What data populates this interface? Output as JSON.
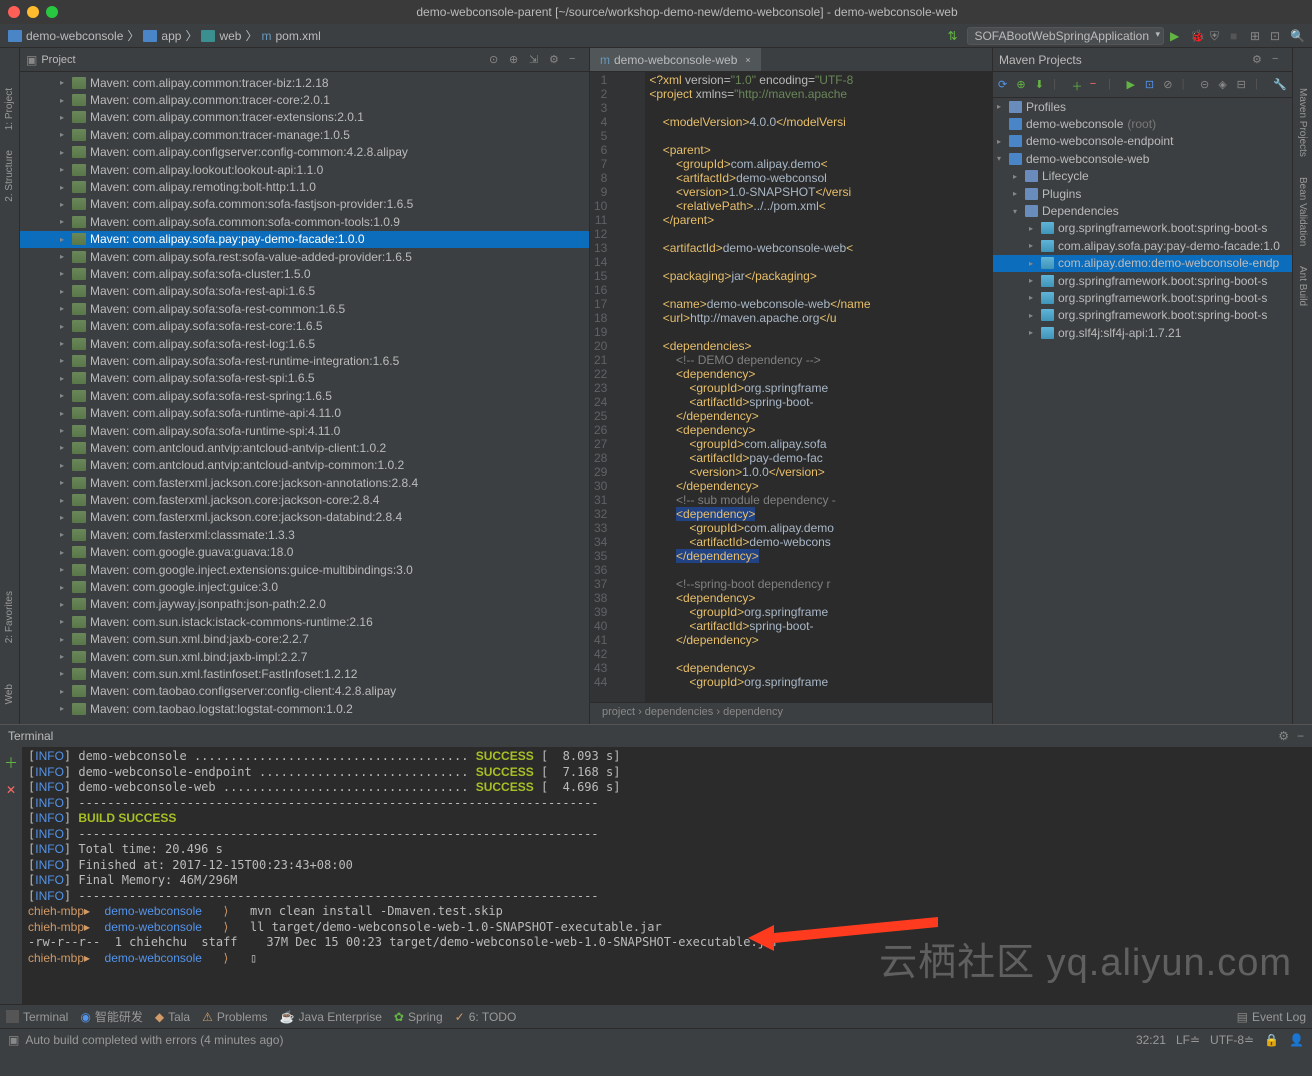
{
  "title": "demo-webconsole-parent [~/source/workshop-demo-new/demo-webconsole] - demo-webconsole-web",
  "breadcrumbs": [
    "demo-webconsole",
    "app",
    "web",
    "pom.xml"
  ],
  "run_config": "SOFABootWebSpringApplication",
  "project": {
    "title": "Project",
    "items": [
      {
        "t": "Maven: com.alipay.common:tracer-biz:1.2.18"
      },
      {
        "t": "Maven: com.alipay.common:tracer-core:2.0.1"
      },
      {
        "t": "Maven: com.alipay.common:tracer-extensions:2.0.1"
      },
      {
        "t": "Maven: com.alipay.common:tracer-manage:1.0.5"
      },
      {
        "t": "Maven: com.alipay.configserver:config-common:4.2.8.alipay"
      },
      {
        "t": "Maven: com.alipay.lookout:lookout-api:1.1.0"
      },
      {
        "t": "Maven: com.alipay.remoting:bolt-http:1.1.0"
      },
      {
        "t": "Maven: com.alipay.sofa.common:sofa-fastjson-provider:1.6.5"
      },
      {
        "t": "Maven: com.alipay.sofa.common:sofa-common-tools:1.0.9"
      },
      {
        "t": "Maven: com.alipay.sofa.pay:pay-demo-facade:1.0.0",
        "sel": true
      },
      {
        "t": "Maven: com.alipay.sofa.rest:sofa-value-added-provider:1.6.5"
      },
      {
        "t": "Maven: com.alipay.sofa:sofa-cluster:1.5.0"
      },
      {
        "t": "Maven: com.alipay.sofa:sofa-rest-api:1.6.5"
      },
      {
        "t": "Maven: com.alipay.sofa:sofa-rest-common:1.6.5"
      },
      {
        "t": "Maven: com.alipay.sofa:sofa-rest-core:1.6.5"
      },
      {
        "t": "Maven: com.alipay.sofa:sofa-rest-log:1.6.5"
      },
      {
        "t": "Maven: com.alipay.sofa:sofa-rest-runtime-integration:1.6.5"
      },
      {
        "t": "Maven: com.alipay.sofa:sofa-rest-spi:1.6.5"
      },
      {
        "t": "Maven: com.alipay.sofa:sofa-rest-spring:1.6.5"
      },
      {
        "t": "Maven: com.alipay.sofa:sofa-runtime-api:4.11.0"
      },
      {
        "t": "Maven: com.alipay.sofa:sofa-runtime-spi:4.11.0"
      },
      {
        "t": "Maven: com.antcloud.antvip:antcloud-antvip-client:1.0.2"
      },
      {
        "t": "Maven: com.antcloud.antvip:antcloud-antvip-common:1.0.2"
      },
      {
        "t": "Maven: com.fasterxml.jackson.core:jackson-annotations:2.8.4"
      },
      {
        "t": "Maven: com.fasterxml.jackson.core:jackson-core:2.8.4"
      },
      {
        "t": "Maven: com.fasterxml.jackson.core:jackson-databind:2.8.4"
      },
      {
        "t": "Maven: com.fasterxml:classmate:1.3.3"
      },
      {
        "t": "Maven: com.google.guava:guava:18.0"
      },
      {
        "t": "Maven: com.google.inject.extensions:guice-multibindings:3.0"
      },
      {
        "t": "Maven: com.google.inject:guice:3.0"
      },
      {
        "t": "Maven: com.jayway.jsonpath:json-path:2.2.0"
      },
      {
        "t": "Maven: com.sun.istack:istack-commons-runtime:2.16"
      },
      {
        "t": "Maven: com.sun.xml.bind:jaxb-core:2.2.7"
      },
      {
        "t": "Maven: com.sun.xml.bind:jaxb-impl:2.2.7"
      },
      {
        "t": "Maven: com.sun.xml.fastinfoset:FastInfoset:1.2.12"
      },
      {
        "t": "Maven: com.taobao.configserver:config-client:4.2.8.alipay"
      },
      {
        "t": "Maven: com.taobao.logstat:logstat-common:1.0.2"
      }
    ]
  },
  "editor": {
    "tab": "demo-webconsole-web",
    "crumbs": "project   ›   dependencies   ›   dependency"
  },
  "maven": {
    "title": "Maven Projects",
    "profiles": "Profiles",
    "root": "demo-webconsole",
    "root_suffix": "(root)",
    "ep": "demo-webconsole-endpoint",
    "web": "demo-webconsole-web",
    "lc": "Lifecycle",
    "pl": "Plugins",
    "dep": "Dependencies",
    "deps": [
      "org.springframework.boot:spring-boot-s",
      "com.alipay.sofa.pay:pay-demo-facade:1.0",
      "com.alipay.demo:demo-webconsole-endp",
      "org.springframework.boot:spring-boot-s",
      "org.springframework.boot:spring-boot-s",
      "org.springframework.boot:spring-boot-s",
      "org.slf4j:slf4j-api:1.7.21"
    ]
  },
  "terminal": {
    "title": "Terminal",
    "l1": "demo-webconsole ......................................",
    "l1b": "[  8.093 s]",
    "l2": "demo-webconsole-endpoint .............................",
    "l2b": "[  7.168 s]",
    "l3": "demo-webconsole-web ..................................",
    "l3b": "[  4.696 s]",
    "dash": "------------------------------------------------------------------------",
    "bs": "BUILD SUCCESS",
    "tot": "Total time: 20.496 s",
    "fin": "Finished at: 2017-12-15T00:23:43+08:00",
    "mem": "Final Memory: 46M/296M",
    "p": "chieh-mbp▸",
    "d": "demo-webconsole",
    "c1": "mvn clean install -Dmaven.test.skip",
    "c2": "ll target/demo-webconsole-web-1.0-SNAPSHOT-executable.jar",
    "c3": "-rw-r--r--  1 chiehchu  staff    37M Dec 15 00:23 target/demo-webconsole-web-1.0-SNAPSHOT-executable.jar",
    "cursor": "▯"
  },
  "bottom_tabs": [
    "Terminal",
    "智能研发",
    "Tala",
    "Problems",
    "Java Enterprise",
    "Spring",
    "6: TODO"
  ],
  "bottom_right": "Event Log",
  "status": {
    "msg": "Auto build completed with errors (4 minutes ago)",
    "pos": "32:21",
    "le": "LF≐",
    "enc": "UTF-8≐"
  },
  "left_stripe": [
    "1: Project",
    "2. Structure"
  ],
  "right_stripe": [
    "Maven Projects",
    "Bean Validation",
    "Ant Build"
  ],
  "fav": "2: Favorites",
  "wb": "Web",
  "watermark": "云栖社区  yq.aliyun.com"
}
